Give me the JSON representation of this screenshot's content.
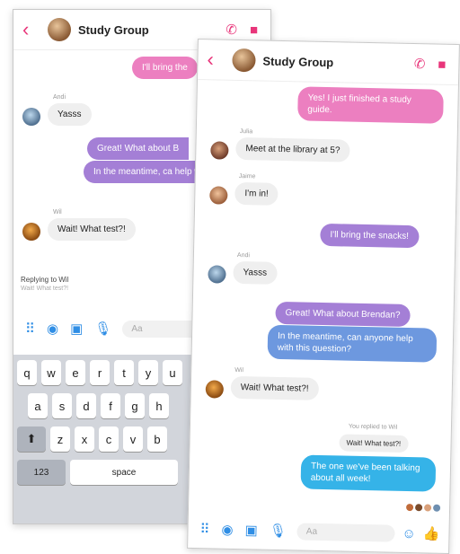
{
  "back_phone": {
    "title": "Study Group",
    "messages": {
      "top_out": "I'll bring the",
      "andi_label": "Andi",
      "andi_msg": "Yasss",
      "out1": "Great! What about B",
      "out2": "In the meantime, ca help with this questi",
      "wil_label": "Wil",
      "wil_msg": "Wait! What test?!"
    },
    "reply": {
      "title": "Replying to Wil",
      "subtitle": "Wait! What test?!"
    },
    "composer": {
      "placeholder": "Aa"
    },
    "keyboard": {
      "row1": [
        "q",
        "w",
        "e",
        "r",
        "t",
        "y",
        "u"
      ],
      "row2": [
        "a",
        "s",
        "d",
        "f",
        "g",
        "h"
      ],
      "row3": [
        "⬆",
        "z",
        "x",
        "c",
        "v",
        "b"
      ],
      "num_key": "123",
      "space_key": "space"
    }
  },
  "front_phone": {
    "title": "Study Group",
    "messages": {
      "m1": "Yes! I just finished a study guide.",
      "julia_label": "Julia",
      "m2": "Meet at the library at 5?",
      "jaime_label": "Jaime",
      "m3": "I'm in!",
      "m4": "I'll bring the snacks!",
      "andi_label": "Andi",
      "m5": "Yasss",
      "m6": "Great! What about Brendan?",
      "m7": "In the meantime, can anyone help with this question?",
      "wil_label": "Wil",
      "m8": "Wait! What test?!",
      "reply_note": "You replied to Wil",
      "reply_quote": "Wait! What test?!",
      "m9": "The one we've been talking about all week!"
    },
    "composer": {
      "placeholder": "Aa"
    }
  },
  "colors": {
    "accent": "#e8357a",
    "messenger_blue": "#2f8ee5"
  }
}
